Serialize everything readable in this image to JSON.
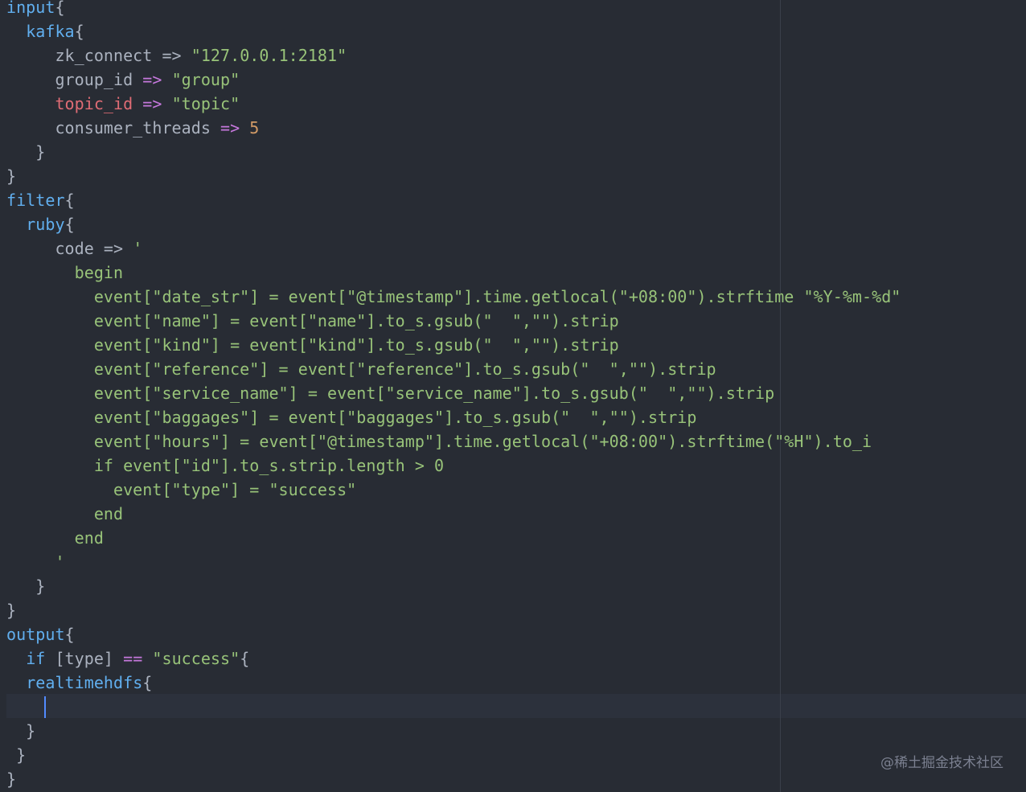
{
  "colors": {
    "background": "#282c34",
    "keyword": "#61afef",
    "text": "#abb2bf",
    "error": "#e06c75",
    "operator": "#c678dd",
    "string": "#98c379",
    "number": "#d19a66",
    "cursor": "#528bff"
  },
  "watermark": "@稀土掘金技术社区",
  "lines": [
    [
      {
        "t": "input",
        "c": "key"
      },
      {
        "t": "{",
        "c": "plain"
      }
    ],
    [
      {
        "t": "  "
      },
      {
        "t": "kafka",
        "c": "key"
      },
      {
        "t": "{",
        "c": "plain"
      }
    ],
    [
      {
        "t": "     zk_connect ",
        "c": "prop"
      },
      {
        "t": "=>",
        "c": "prop"
      },
      {
        "t": " "
      },
      {
        "t": "\"127.0.0.1:2181\"",
        "c": "str"
      }
    ],
    [
      {
        "t": "     group_id ",
        "c": "prop"
      },
      {
        "t": "=>",
        "c": "op"
      },
      {
        "t": " "
      },
      {
        "t": "\"group\"",
        "c": "str"
      }
    ],
    [
      {
        "t": "     "
      },
      {
        "t": "topic_id",
        "c": "err"
      },
      {
        "t": " "
      },
      {
        "t": "=>",
        "c": "op"
      },
      {
        "t": " "
      },
      {
        "t": "\"topic\"",
        "c": "str"
      }
    ],
    [
      {
        "t": "     consumer_threads ",
        "c": "prop"
      },
      {
        "t": "=>",
        "c": "op"
      },
      {
        "t": " "
      },
      {
        "t": "5",
        "c": "num"
      }
    ],
    [
      {
        "t": "   }",
        "c": "plain"
      }
    ],
    [
      {
        "t": "}",
        "c": "plain"
      }
    ],
    [
      {
        "t": "filter",
        "c": "key"
      },
      {
        "t": "{",
        "c": "plain"
      }
    ],
    [
      {
        "t": "  "
      },
      {
        "t": "ruby",
        "c": "key"
      },
      {
        "t": "{",
        "c": "plain"
      }
    ],
    [
      {
        "t": "     code ",
        "c": "prop"
      },
      {
        "t": "=>",
        "c": "prop"
      },
      {
        "t": " "
      },
      {
        "t": "'",
        "c": "str"
      }
    ],
    [
      {
        "t": "       begin",
        "c": "str"
      }
    ],
    [
      {
        "t": "         event[\"date_str\"] = event[\"@timestamp\"].time.getlocal(\"+08:00\").strftime \"%Y-%m-%d\"",
        "c": "str"
      }
    ],
    [
      {
        "t": "         event[\"name\"] = event[\"name\"].to_s.gsub(\"  \",\"\").strip",
        "c": "str"
      }
    ],
    [
      {
        "t": "         event[\"kind\"] = event[\"kind\"].to_s.gsub(\"  \",\"\").strip",
        "c": "str"
      }
    ],
    [
      {
        "t": "         event[\"reference\"] = event[\"reference\"].to_s.gsub(\"  \",\"\").strip",
        "c": "str"
      }
    ],
    [
      {
        "t": "         event[\"service_name\"] = event[\"service_name\"].to_s.gsub(\"  \",\"\").strip",
        "c": "str"
      }
    ],
    [
      {
        "t": "         event[\"baggages\"] = event[\"baggages\"].to_s.gsub(\"  \",\"\").strip",
        "c": "str"
      }
    ],
    [
      {
        "t": "         event[\"hours\"] = event[\"@timestamp\"].time.getlocal(\"+08:00\").strftime(\"%H\").to_i",
        "c": "str"
      }
    ],
    [
      {
        "t": "         if event[\"id\"].to_s.strip.length > 0",
        "c": "str"
      }
    ],
    [
      {
        "t": "           event[\"type\"] = \"success\"",
        "c": "str"
      }
    ],
    [
      {
        "t": "         end",
        "c": "str"
      }
    ],
    [
      {
        "t": "       end",
        "c": "str"
      }
    ],
    [
      {
        "t": "     '",
        "c": "str"
      }
    ],
    [
      {
        "t": "   }",
        "c": "plain"
      }
    ],
    [
      {
        "t": "}",
        "c": "plain"
      }
    ],
    [
      {
        "t": "output",
        "c": "key"
      },
      {
        "t": "{",
        "c": "plain"
      }
    ],
    [
      {
        "t": "  "
      },
      {
        "t": "if",
        "c": "key"
      },
      {
        "t": " [type] ",
        "c": "prop"
      },
      {
        "t": "==",
        "c": "op"
      },
      {
        "t": " "
      },
      {
        "t": "\"success\"",
        "c": "str"
      },
      {
        "t": "{",
        "c": "plain"
      }
    ],
    [
      {
        "t": "  "
      },
      {
        "t": "realtimehdfs",
        "c": "key"
      },
      {
        "t": "{",
        "c": "plain"
      }
    ],
    [
      {
        "t": ""
      }
    ],
    [
      {
        "t": "  }",
        "c": "plain"
      }
    ],
    [
      {
        "t": " }",
        "c": "plain"
      }
    ],
    [
      {
        "t": "}",
        "c": "plain"
      }
    ]
  ]
}
